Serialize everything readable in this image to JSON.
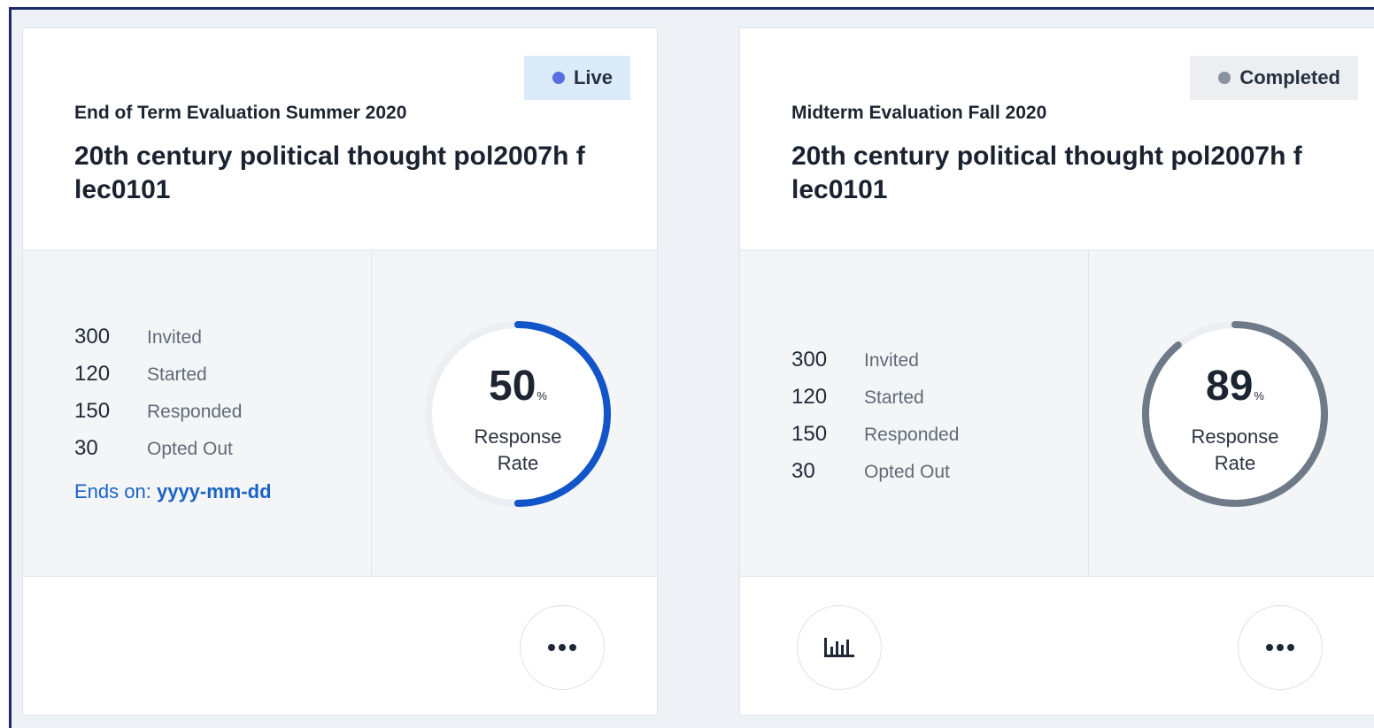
{
  "cards": [
    {
      "status": {
        "label": "Live",
        "dot_color": "#5b6ee1"
      },
      "eval_title": "End of Term Evaluation Summer 2020",
      "course_title": "20th century political thought pol2007h f lec0101",
      "stats": [
        {
          "value": "300",
          "label": "Invited"
        },
        {
          "value": "120",
          "label": "Started"
        },
        {
          "value": "150",
          "label": "Responded"
        },
        {
          "value": "30",
          "label": "Opted Out"
        }
      ],
      "ends_label": "Ends on:",
      "ends_value": "yyyy-mm-dd",
      "response_rate": {
        "value": "50",
        "unit": "%",
        "label_line1": "Response",
        "label_line2": "Rate",
        "fraction": 0.5,
        "color": "#1255c8"
      },
      "more_icon": "more-horizontal-icon"
    },
    {
      "status": {
        "label": "Completed",
        "dot_color": "#8a929d"
      },
      "eval_title": "Midterm Evaluation Fall 2020",
      "course_title": "20th century political thought pol2007h f lec0101",
      "stats": [
        {
          "value": "300",
          "label": "Invited"
        },
        {
          "value": "120",
          "label": "Started"
        },
        {
          "value": "150",
          "label": "Responded"
        },
        {
          "value": "30",
          "label": "Opted Out"
        }
      ],
      "response_rate": {
        "value": "89",
        "unit": "%",
        "label_line1": "Response",
        "label_line2": "Rate",
        "fraction": 0.89,
        "color": "#6e7a88"
      },
      "chart_icon": "bar-chart-icon",
      "more_icon": "more-horizontal-icon"
    }
  ]
}
